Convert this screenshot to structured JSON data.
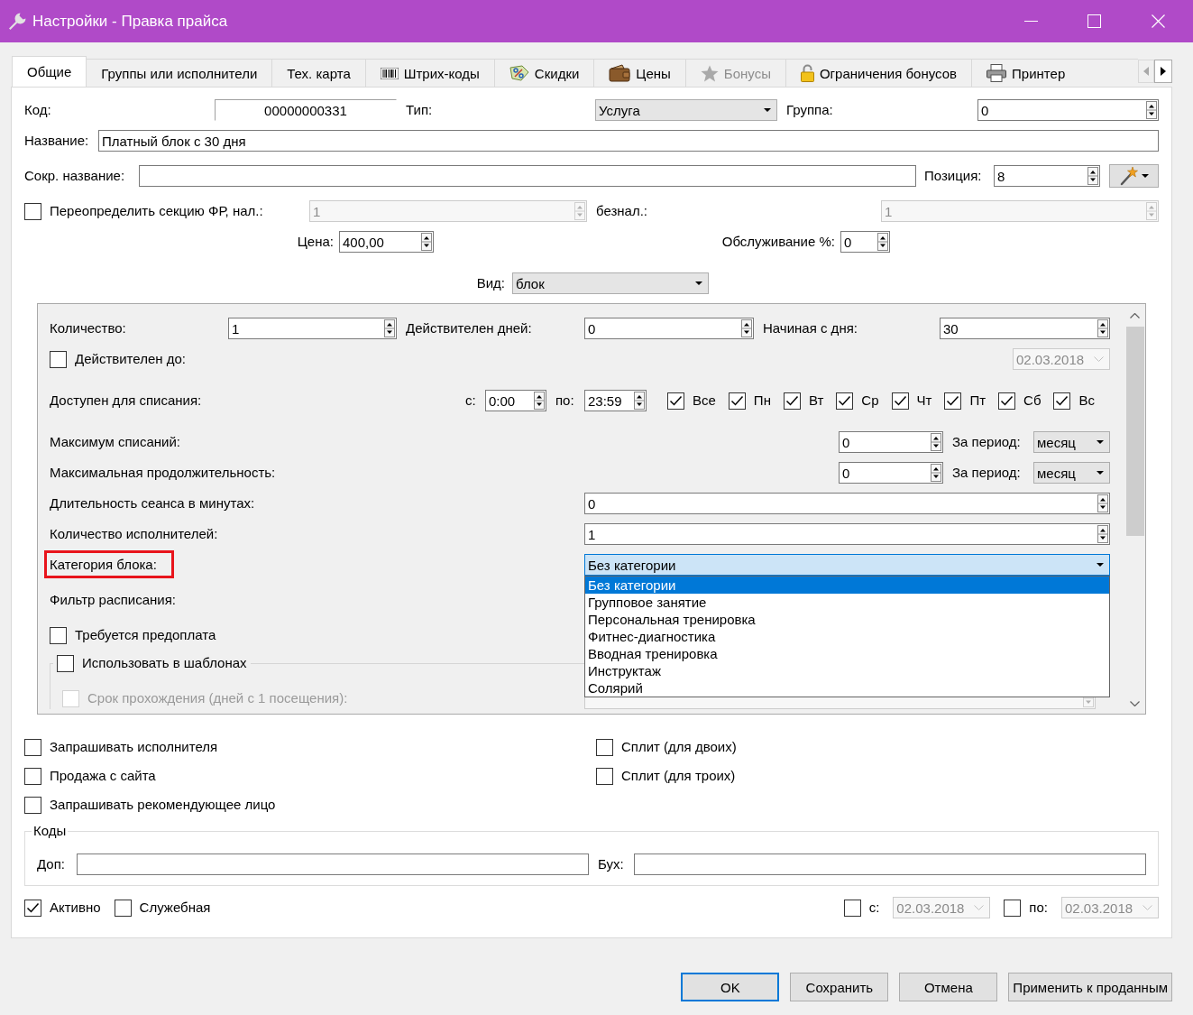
{
  "window": {
    "title": "Настройки - Правка прайса"
  },
  "tabs": [
    {
      "label": "Общие",
      "selected": true,
      "disabled": false
    },
    {
      "label": "Группы или исполнители",
      "selected": false,
      "disabled": false
    },
    {
      "label": "Тех. карта",
      "selected": false,
      "disabled": false
    },
    {
      "label": "Штрих-коды",
      "selected": false,
      "disabled": false
    },
    {
      "label": "Скидки",
      "selected": false,
      "disabled": false
    },
    {
      "label": "Цены",
      "selected": false,
      "disabled": false
    },
    {
      "label": "Бонусы",
      "selected": false,
      "disabled": true
    },
    {
      "label": "Ограничения бонусов",
      "selected": false,
      "disabled": false
    },
    {
      "label": "Принтер",
      "selected": false,
      "disabled": false
    }
  ],
  "general": {
    "code": {
      "label": "Код:",
      "value": "00000000331"
    },
    "type": {
      "label": "Тип:",
      "value": "Услуга"
    },
    "group": {
      "label": "Группа:",
      "value": "0"
    },
    "name": {
      "label": "Название:",
      "value": "Платный блок с 30 дня"
    },
    "short_name": {
      "label": "Сокр. название:"
    },
    "position": {
      "label": "Позиция:",
      "value": "8"
    },
    "fr_section": {
      "label": "Переопределить секцию ФР, нал.:",
      "checked": false,
      "cash": {
        "value": "1",
        "disabled": true
      },
      "cashless_label": "безнал.:",
      "cashless": {
        "value": "1",
        "disabled": true
      }
    },
    "price": {
      "label": "Цена:",
      "value": "400,00"
    },
    "service": {
      "label": "Обслуживание %:",
      "value": "0"
    },
    "view": {
      "label": "Вид:",
      "value": "блок"
    }
  },
  "block": {
    "quantity": {
      "label": "Количество:",
      "value": "1"
    },
    "valid_days": {
      "label": "Действителен дней:",
      "value": "0"
    },
    "start_day": {
      "label": "Начиная с дня:",
      "value": "30"
    },
    "valid_until": {
      "label": "Действителен до:",
      "checked": false,
      "date": {
        "value": "02.03.2018",
        "disabled": true
      }
    },
    "write_off": {
      "label": "Доступен для списания:",
      "from_label": "с:",
      "from": "0:00",
      "to_label": "по:",
      "to": "23:59"
    },
    "days": [
      {
        "label": "Все",
        "checked": true
      },
      {
        "label": "Пн",
        "checked": true
      },
      {
        "label": "Вт",
        "checked": true
      },
      {
        "label": "Ср",
        "checked": true
      },
      {
        "label": "Чт",
        "checked": true
      },
      {
        "label": "Пт",
        "checked": true
      },
      {
        "label": "Сб",
        "checked": true
      },
      {
        "label": "Вс",
        "checked": true
      }
    ],
    "limits": [
      {
        "label": "Максимум списаний:",
        "value": "0",
        "period_label": "За период:",
        "period": "месяц"
      },
      {
        "label": "Максимальная продолжительность:",
        "value": "0",
        "period_label": "За период:",
        "period": "месяц"
      }
    ],
    "counts": [
      {
        "label": "Длительность сеанса в минутах:",
        "value": "0"
      },
      {
        "label": "Количество исполнителей:",
        "value": "1"
      }
    ],
    "category": {
      "label": "Категория блока:",
      "annotated": true,
      "value": "Без категории",
      "focused": true,
      "expanded": true,
      "options": [
        {
          "label": "Без категории",
          "selected": true
        },
        {
          "label": "Групповое занятие",
          "selected": false
        },
        {
          "label": "Персональная тренировка",
          "selected": false
        },
        {
          "label": "Фитнес-диагностика",
          "selected": false
        },
        {
          "label": "Вводная тренировка",
          "selected": false
        },
        {
          "label": "Инструктаж",
          "selected": false
        },
        {
          "label": "Солярий",
          "selected": false
        }
      ]
    },
    "schedule_filter": {
      "label": "Фильтр расписания:"
    },
    "prepayment": {
      "label": "Требуется предоплата",
      "checked": false
    },
    "templates": {
      "label": "Использовать в шаблонах",
      "checked": false
    },
    "completion_term": {
      "label": "Срок прохождения (дней с 1 посещения):",
      "checked": false,
      "disabled": true
    }
  },
  "options": [
    {
      "label": "Запрашивать исполнителя",
      "checked": false
    },
    {
      "label": "Сплит (для двоих)",
      "checked": false
    },
    {
      "label": "Продажа с сайта",
      "checked": false
    },
    {
      "label": "Сплит (для троих)",
      "checked": false
    },
    {
      "label": "Запрашивать рекомендующее лицо",
      "checked": false
    }
  ],
  "codes": {
    "title": "Коды",
    "extra_label": "Доп:",
    "accounting_label": "Бух:"
  },
  "status": [
    {
      "label": "Активно",
      "checked": true
    },
    {
      "label": "Служебная",
      "checked": false
    }
  ],
  "period": [
    {
      "label": "с:",
      "checked": false,
      "date": "02.03.2018",
      "disabled": true
    },
    {
      "label": "по:",
      "checked": false,
      "date": "02.03.2018",
      "disabled": true
    }
  ],
  "buttons": [
    {
      "label": "OK",
      "default": true
    },
    {
      "label": "Сохранить",
      "default": false
    },
    {
      "label": "Отмена",
      "default": false
    },
    {
      "label": "Применить к проданным",
      "default": false
    }
  ]
}
